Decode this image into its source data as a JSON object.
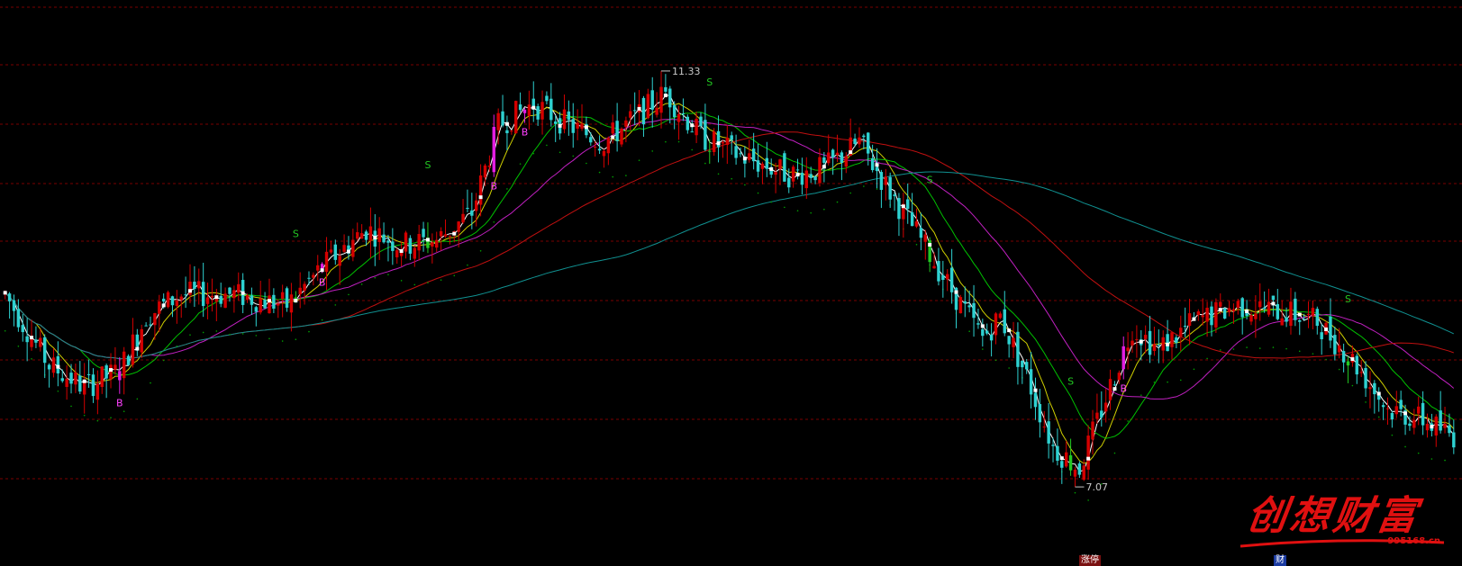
{
  "chart_data": {
    "type": "candlestick",
    "title": "",
    "y_range": [
      6.6,
      11.6
    ],
    "price_levels": [
      11.0,
      10.0,
      9.0,
      8.0
    ],
    "high_label": "11.33",
    "low_label": "7.07",
    "bullish_color": "#d40000",
    "bearish_color": "#2ed1d1",
    "buy_bar_color": "#e21ee2",
    "sell_bar_color": "#22c822",
    "ma_colors": [
      "#ffffff",
      "#cfcf00",
      "#00c000",
      "#c020c0",
      "#c01010",
      "#109090"
    ],
    "signals": [
      {
        "label": "S",
        "index": 66,
        "type": "sell"
      },
      {
        "label": "B",
        "index": 118,
        "type": "buy"
      },
      {
        "label": "S",
        "index": 96,
        "type": "sell"
      },
      {
        "label": "S",
        "index": 210,
        "type": "sell"
      },
      {
        "label": "B",
        "index": 72,
        "type": "buy"
      },
      {
        "label": "B",
        "index": 111,
        "type": "buy"
      },
      {
        "label": "S",
        "index": 160,
        "type": "sell"
      },
      {
        "label": "S",
        "index": 242,
        "type": "sell"
      },
      {
        "label": "B",
        "index": 26,
        "type": "buy"
      },
      {
        "label": "S",
        "index": 305,
        "type": "sell"
      },
      {
        "label": "B",
        "index": 254,
        "type": "buy"
      }
    ]
  },
  "watermark": {
    "text": "创想财富",
    "url": "995168.cn"
  },
  "bottom_tags": {
    "left": "涨停",
    "right": "财"
  }
}
